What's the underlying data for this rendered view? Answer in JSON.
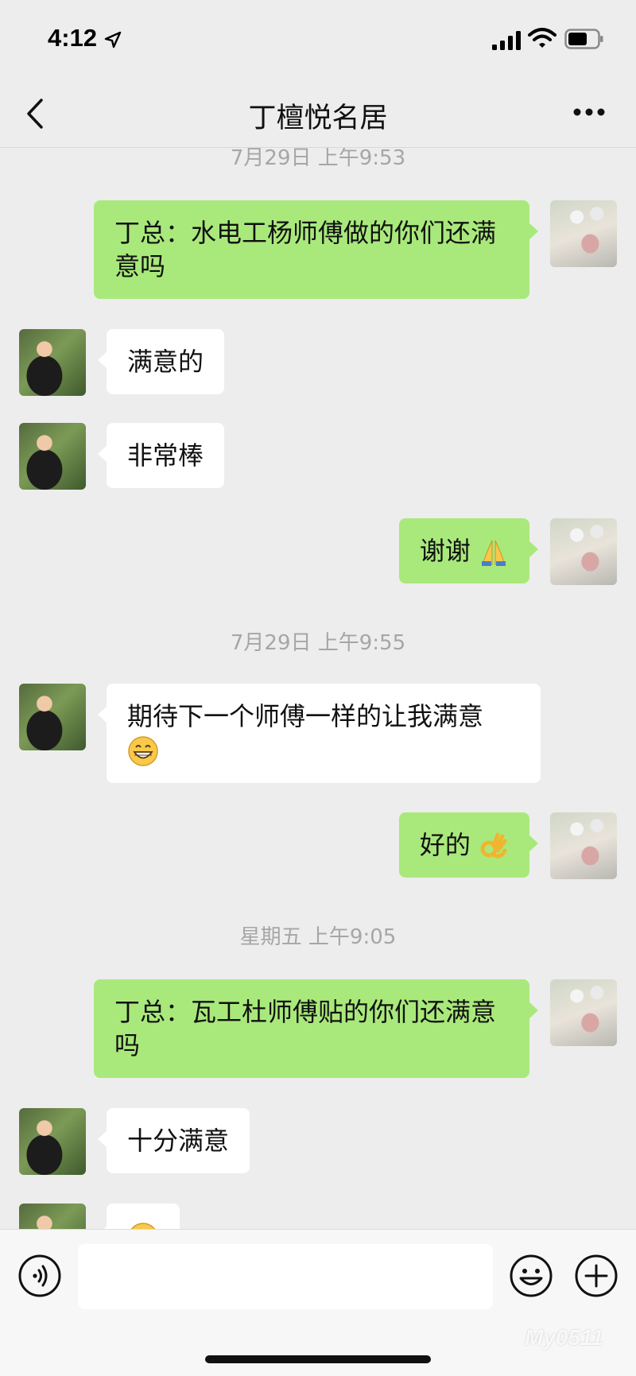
{
  "status_bar": {
    "time": "4:12",
    "location_icon": "location-arrow-icon",
    "signal_icon": "cellular-signal-icon",
    "wifi_icon": "wifi-icon",
    "battery_icon": "battery-icon"
  },
  "header": {
    "title": "丁檀悦名居",
    "back_icon": "chevron-left-icon",
    "more_icon": "more-dots-icon"
  },
  "messages": [
    {
      "type": "timestamp",
      "text": "7月29日 上午9:53"
    },
    {
      "type": "message",
      "sender": "me",
      "text": "丁总：水电工杨师傅做的你们还满意吗"
    },
    {
      "type": "message",
      "sender": "them",
      "text": "满意的"
    },
    {
      "type": "message",
      "sender": "them",
      "text": "非常棒"
    },
    {
      "type": "message",
      "sender": "me",
      "text": "谢谢",
      "emoji": "folded-hands-emoji"
    },
    {
      "type": "timestamp",
      "text": "7月29日 上午9:55"
    },
    {
      "type": "message",
      "sender": "them",
      "text": "期待下一个师傅一样的让我满意",
      "emoji": "grinning-face-emoji"
    },
    {
      "type": "message",
      "sender": "me",
      "text": "好的",
      "emoji": "ok-hand-emoji"
    },
    {
      "type": "timestamp",
      "text": "星期五 上午9:05"
    },
    {
      "type": "message",
      "sender": "me",
      "text": "丁总：瓦工杜师傅贴的你们还满意吗"
    },
    {
      "type": "message",
      "sender": "them",
      "text": "十分满意"
    },
    {
      "type": "message",
      "sender": "them",
      "text": "",
      "emoji": "grinning-face-emoji"
    }
  ],
  "input_bar": {
    "voice_icon": "voice-icon",
    "text_value": "",
    "emoji_icon": "smiley-face-icon",
    "plus_icon": "plus-circle-icon"
  },
  "colors": {
    "background": "#ededed",
    "my_bubble": "#a9e97b",
    "their_bubble": "#ffffff",
    "timestamp_text": "#a6a6a6"
  },
  "watermark": "My0511"
}
